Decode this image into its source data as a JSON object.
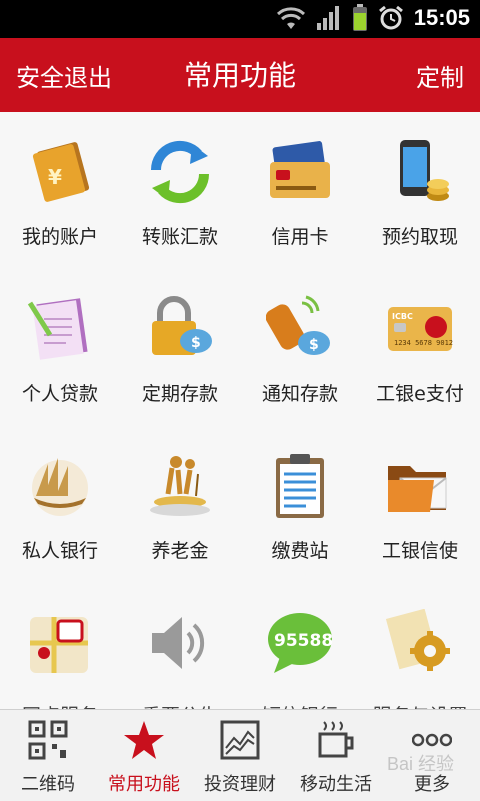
{
  "status": {
    "time": "15:05"
  },
  "header": {
    "left": "安全退出",
    "title": "常用功能",
    "right": "定制"
  },
  "grid": {
    "items": [
      {
        "label": "我的账户",
        "icon": "account-book-icon"
      },
      {
        "label": "转账汇款",
        "icon": "transfer-arrows-icon"
      },
      {
        "label": "信用卡",
        "icon": "credit-card-icon"
      },
      {
        "label": "预约取现",
        "icon": "phone-coins-icon"
      },
      {
        "label": "个人贷款",
        "icon": "loan-document-icon"
      },
      {
        "label": "定期存款",
        "icon": "lock-piggybank-icon"
      },
      {
        "label": "通知存款",
        "icon": "phone-piggybank-icon"
      },
      {
        "label": "工银e支付",
        "icon": "icbc-card-icon"
      },
      {
        "label": "私人银行",
        "icon": "sailboat-icon"
      },
      {
        "label": "养老金",
        "icon": "elderly-trophy-icon"
      },
      {
        "label": "缴费站",
        "icon": "clipboard-icon"
      },
      {
        "label": "工银信使",
        "icon": "mail-folder-icon"
      },
      {
        "label": "网点服务",
        "icon": "map-pin-icon"
      },
      {
        "label": "重要公告",
        "icon": "speaker-icon"
      },
      {
        "label": "短信银行",
        "icon": "sms-95588-icon"
      },
      {
        "label": "服务与设置",
        "icon": "gear-settings-icon"
      }
    ],
    "sms_number": "95588",
    "icbc_card_brand": "ICBC"
  },
  "tabbar": {
    "tabs": [
      {
        "label": "二维码",
        "icon": "qr-code-icon"
      },
      {
        "label": "常用功能",
        "icon": "star-icon",
        "active": true
      },
      {
        "label": "投资理财",
        "icon": "chart-icon"
      },
      {
        "label": "移动生活",
        "icon": "coffee-cup-icon"
      },
      {
        "label": "更多",
        "icon": "more-dots-icon"
      }
    ]
  },
  "watermark": "Bai 经验",
  "colors": {
    "brand_red": "#c8101d"
  }
}
